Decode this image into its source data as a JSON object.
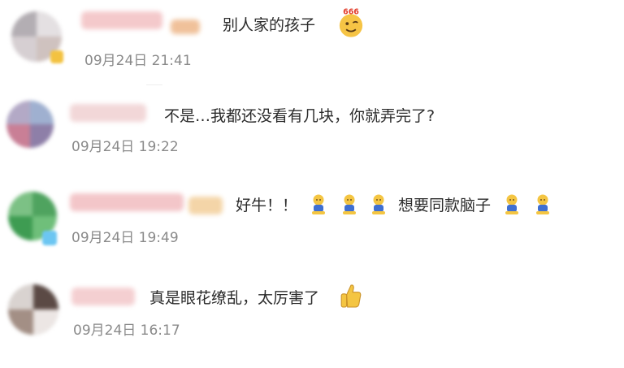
{
  "comments": [
    {
      "text": "别人家的孩子",
      "emojis": [
        "awesome-666-emoji"
      ],
      "timestamp": "09月24日 21:41"
    },
    {
      "text": "不是…我都还没看有几块，你就弄完了?",
      "emojis": [],
      "timestamp": "09月24日 19:22"
    },
    {
      "text_before": "好牛！！",
      "text_after": "想要同款脑子",
      "emojis": [
        "kneel-emoji",
        "kneel-emoji",
        "kneel-emoji",
        "kneel-emoji",
        "kneel-emoji"
      ],
      "timestamp": "09月24日 19:49"
    },
    {
      "text": "真是眼花缭乱，太厉害了",
      "emojis": [
        "thumbs-up-emoji"
      ],
      "timestamp": "09月24日 16:17"
    }
  ],
  "colors": {
    "text": "#2b2b2b",
    "timestamp": "#8a8a8a",
    "name_blur": "#f3c7c7",
    "emoji_yellow": "#f4c542"
  }
}
